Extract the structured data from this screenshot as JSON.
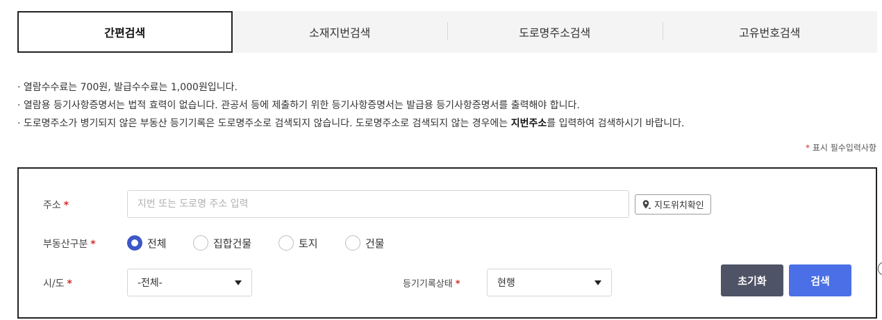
{
  "tabs": [
    {
      "label": "간편검색",
      "active": true
    },
    {
      "label": "소재지번검색",
      "active": false
    },
    {
      "label": "도로명주소검색",
      "active": false
    },
    {
      "label": "고유번호검색",
      "active": false
    }
  ],
  "notices": [
    {
      "text": "· 열람수수료는  700원, 발급수수료는  1,000원입니다."
    },
    {
      "text": "· 열람용 등기사항증명서는 법적 효력이 없습니다. 관공서 등에 제출하기 위한 등기사항증명서는 발급용 등기사항증명서를 출력해야 합니다."
    },
    {
      "before": "· 도로명주소가 병기되지 않은 부동산 등기기록은 도로명주소로 검색되지 않습니다. 도로명주소로 검색되지 않는 경우에는 ",
      "bold": "지번주소",
      "after": "를 입력하여 검색하시기 바랍니다."
    }
  ],
  "required_note": {
    "star": "*",
    "text": "표시 필수입력사항"
  },
  "form": {
    "required_star": "*",
    "address": {
      "label": "주소",
      "placeholder": "지번 또는 도로명 주소 입력",
      "value": "",
      "map_button": "지도위치확인"
    },
    "property_type": {
      "label": "부동산구분",
      "options": [
        "전체",
        "집합건물",
        "토지",
        "건물"
      ],
      "selected": "전체"
    },
    "sido": {
      "label": "시/도",
      "value": "-전체-"
    },
    "record_status": {
      "label": "등기기록상태",
      "value": "현행"
    },
    "buttons": {
      "reset": "초기화",
      "search": "검색"
    }
  },
  "colors": {
    "accent": "#4a6fe6",
    "radio": "#3d57c7",
    "reset": "#4e5366",
    "required": "#d32f2f"
  }
}
